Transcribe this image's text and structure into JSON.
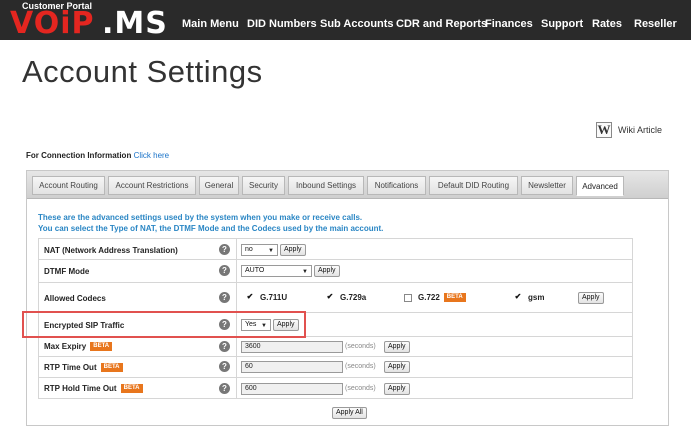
{
  "header": {
    "portal_label": "Customer Portal",
    "logo_red": "VOiP",
    "logo_white": ".MS",
    "nav": [
      "Main Menu",
      "DID Numbers",
      "Sub Accounts",
      "CDR and Reports",
      "Finances",
      "Support",
      "Rates",
      "Reseller"
    ]
  },
  "page": {
    "title": "Account Settings",
    "wiki_icon": "W",
    "wiki_label": "Wiki Article",
    "conn_info_label": "For Connection Information",
    "conn_info_link": "Click here"
  },
  "tabs": [
    "Account Routing",
    "Account Restrictions",
    "General",
    "Security",
    "Inbound Settings",
    "Notifications",
    "Default DID Routing",
    "Newsletter",
    "Advanced"
  ],
  "active_tab": "Advanced",
  "intro": {
    "line1": "These are the advanced settings used by the system when you make or receive calls.",
    "line2": "You can select the Type of NAT, the DTMF Mode and the Codecs used by the main account."
  },
  "settings": {
    "help_glyph": "?",
    "beta_label": "BETA",
    "apply_label": "Apply",
    "seconds_label": "(seconds)",
    "nat": {
      "label": "NAT (Network Address Translation)",
      "value": "no"
    },
    "dtmf": {
      "label": "DTMF Mode",
      "value": "AUTO"
    },
    "codecs": {
      "label": "Allowed Codecs",
      "items": [
        {
          "name": "G.711U",
          "checked": true
        },
        {
          "name": "G.729a",
          "checked": true
        },
        {
          "name": "G.722",
          "checked": false,
          "beta": true
        },
        {
          "name": "gsm",
          "checked": true
        }
      ]
    },
    "encrypted_sip": {
      "label": "Encrypted SIP Traffic",
      "value": "Yes"
    },
    "max_expiry": {
      "label": "Max Expiry",
      "value": "3600"
    },
    "rtp_timeout": {
      "label": "RTP Time Out",
      "value": "60"
    },
    "rtp_hold_timeout": {
      "label": "RTP Hold Time Out",
      "value": "600"
    },
    "apply_all_label": "Apply All"
  },
  "colors": {
    "accent_red": "#e42620",
    "intro_blue": "#2a86c4",
    "beta_orange": "#e8761d",
    "highlight": "#e1514f"
  }
}
